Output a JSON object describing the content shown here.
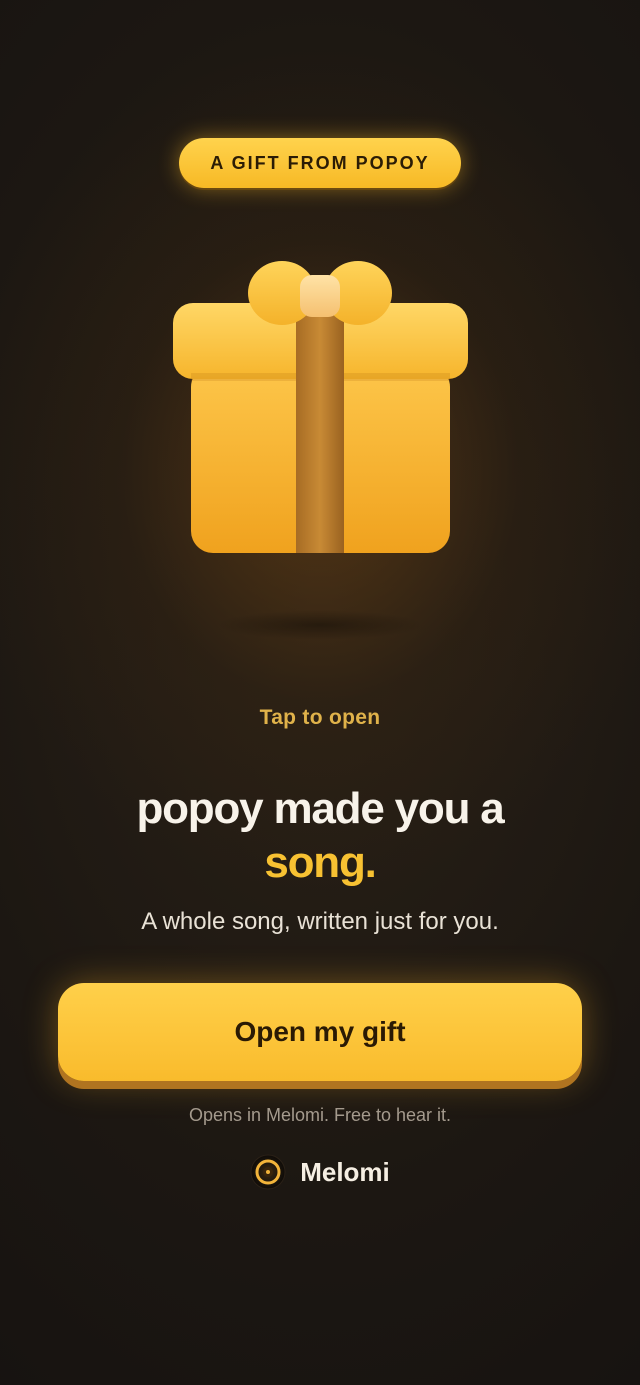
{
  "badge": {
    "label": "A GIFT FROM POPOY"
  },
  "gift": {
    "icon": "gift-box-icon"
  },
  "tap_hint": "Tap to open",
  "headline": {
    "line1": "popoy made you a",
    "accent": "song."
  },
  "subline": "A whole song, written just for you.",
  "cta": {
    "label": "Open my gift"
  },
  "note": "Opens in Melomi. Free to hear it.",
  "brand": {
    "name": "Melomi",
    "icon": "melomi-logo-icon"
  },
  "colors": {
    "accent": "#f7c132",
    "button": "#fbc236",
    "background": "#1c1712",
    "tap_hint": "#e0b24a"
  }
}
